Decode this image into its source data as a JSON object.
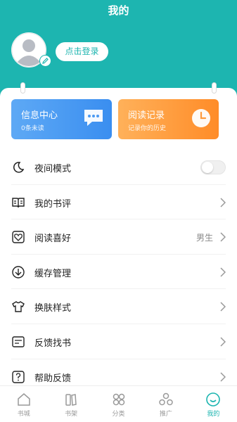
{
  "header": {
    "title": "我的"
  },
  "profile": {
    "login_label": "点击登录"
  },
  "tiles": [
    {
      "title": "信息中心",
      "subtitle": "0条未读",
      "icon": "chat-bubble-icon"
    },
    {
      "title": "阅读记录",
      "subtitle": "记录你的历史",
      "icon": "clock-icon"
    }
  ],
  "menu": {
    "night_mode": {
      "label": "夜间模式",
      "enabled": false
    },
    "reviews": {
      "label": "我的书评"
    },
    "preference": {
      "label": "阅读喜好",
      "value": "男生"
    },
    "cache": {
      "label": "缓存管理"
    },
    "skin": {
      "label": "换肤样式"
    },
    "feedback_book": {
      "label": "反馈找书"
    },
    "help": {
      "label": "帮助反馈"
    }
  },
  "tabbar": {
    "items": [
      {
        "label": "书城",
        "icon": "home-icon"
      },
      {
        "label": "书架",
        "icon": "bookshelf-icon"
      },
      {
        "label": "分类",
        "icon": "category-icon"
      },
      {
        "label": "推广",
        "icon": "promote-icon"
      },
      {
        "label": "我的",
        "icon": "smile-icon",
        "active": true
      }
    ]
  },
  "colors": {
    "accent": "#1db5b0",
    "tile_blue": "#3a8ef0",
    "tile_orange": "#ff8c28"
  }
}
